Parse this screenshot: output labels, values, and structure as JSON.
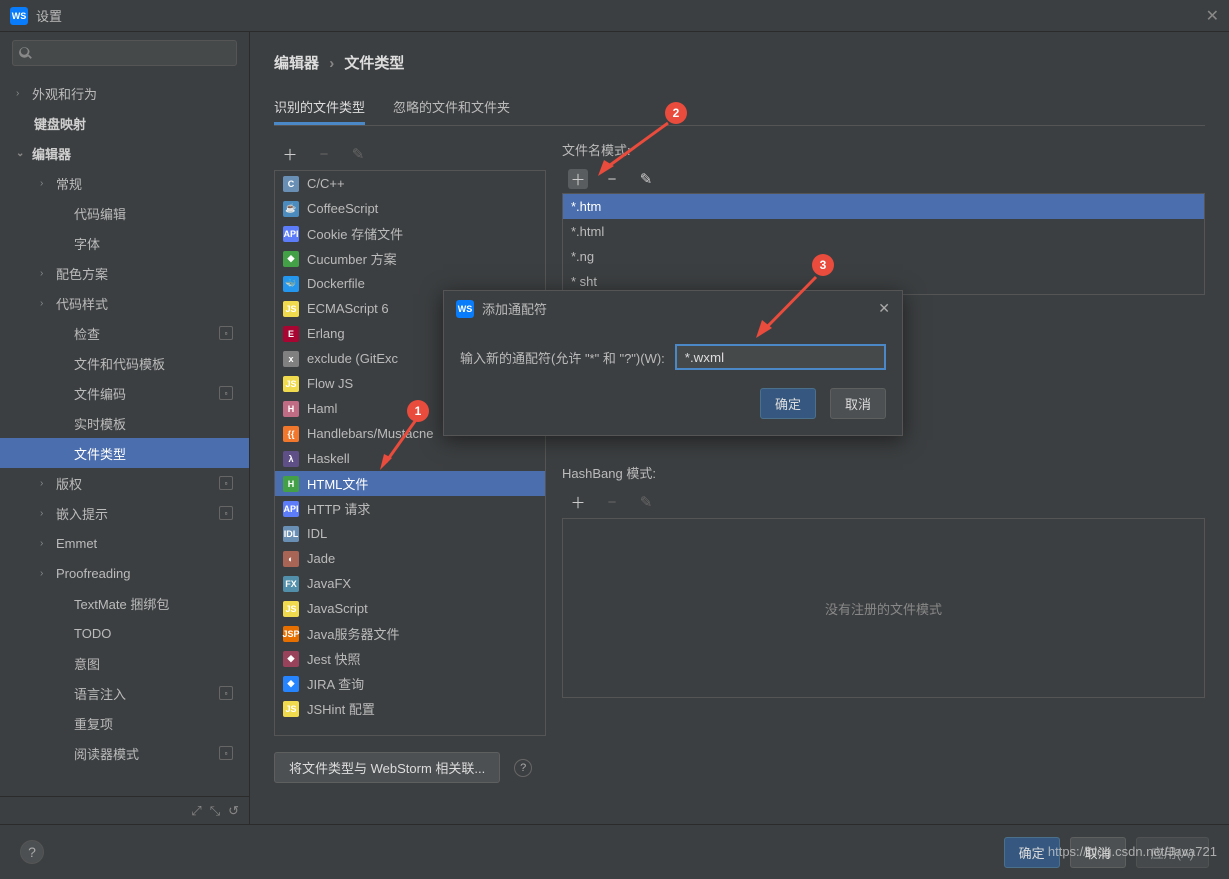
{
  "window": {
    "title": "设置"
  },
  "sidebar": {
    "items": [
      {
        "label": "外观和行为",
        "chev": "›",
        "level": 0
      },
      {
        "label": "键盘映射",
        "level": 0,
        "bold": true
      },
      {
        "label": "编辑器",
        "chev": "⌄",
        "level": 0,
        "bold": true
      },
      {
        "label": "常规",
        "chev": "›",
        "level": 1
      },
      {
        "label": "代码编辑",
        "level": 2
      },
      {
        "label": "字体",
        "level": 2
      },
      {
        "label": "配色方案",
        "chev": "›",
        "level": 1
      },
      {
        "label": "代码样式",
        "chev": "›",
        "level": 1
      },
      {
        "label": "检查",
        "level": 2,
        "badge": true
      },
      {
        "label": "文件和代码模板",
        "level": 2
      },
      {
        "label": "文件编码",
        "level": 2,
        "badge": true
      },
      {
        "label": "实时模板",
        "level": 2
      },
      {
        "label": "文件类型",
        "level": 2,
        "selected": true
      },
      {
        "label": "版权",
        "chev": "›",
        "level": 1,
        "badge": true
      },
      {
        "label": "嵌入提示",
        "chev": "›",
        "level": 1,
        "badge": true
      },
      {
        "label": "Emmet",
        "chev": "›",
        "level": 1
      },
      {
        "label": "Proofreading",
        "chev": "›",
        "level": 1
      },
      {
        "label": "TextMate 捆绑包",
        "level": 2
      },
      {
        "label": "TODO",
        "level": 2
      },
      {
        "label": "意图",
        "level": 2
      },
      {
        "label": "语言注入",
        "level": 2,
        "badge": true
      },
      {
        "label": "重复项",
        "level": 2
      },
      {
        "label": "阅读器模式",
        "level": 2,
        "badge": true
      }
    ]
  },
  "breadcrumb": {
    "a": "编辑器",
    "b": "文件类型"
  },
  "tabs": [
    {
      "label": "识别的文件类型",
      "active": true
    },
    {
      "label": "忽略的文件和文件夹",
      "active": false
    }
  ],
  "filetypes": [
    {
      "label": "C/C++",
      "bg": "#6a8fb5",
      "ic": "C"
    },
    {
      "label": "CoffeeScript",
      "bg": "#4b8bbe",
      "ic": "☕"
    },
    {
      "label": "Cookie 存储文件",
      "bg": "#5c7cfa",
      "ic": "API"
    },
    {
      "label": "Cucumber 方案",
      "bg": "#43a047",
      "ic": "◆"
    },
    {
      "label": "Dockerfile",
      "bg": "#2496ed",
      "ic": "🐳"
    },
    {
      "label": "ECMAScript 6",
      "bg": "#f0db4f",
      "ic": "JS"
    },
    {
      "label": "Erlang",
      "bg": "#a90533",
      "ic": "E"
    },
    {
      "label": "exclude (GitExc",
      "bg": "#808080",
      "ic": "x"
    },
    {
      "label": "Flow JS",
      "bg": "#f0db4f",
      "ic": "JS"
    },
    {
      "label": "Haml",
      "bg": "#c06c84",
      "ic": "H"
    },
    {
      "label": "Handlebars/Mustacne",
      "bg": "#f0772b",
      "ic": "{{"
    },
    {
      "label": "Haskell",
      "bg": "#5e5086",
      "ic": "λ"
    },
    {
      "label": "HTML文件",
      "bg": "#43a047",
      "ic": "H",
      "selected": true
    },
    {
      "label": "HTTP 请求",
      "bg": "#5c7cfa",
      "ic": "API"
    },
    {
      "label": "IDL",
      "bg": "#6a8fb5",
      "ic": "IDL"
    },
    {
      "label": "Jade",
      "bg": "#a86454",
      "ic": "◐"
    },
    {
      "label": "JavaFX",
      "bg": "#518faa",
      "ic": "FX"
    },
    {
      "label": "JavaScript",
      "bg": "#f0db4f",
      "ic": "JS"
    },
    {
      "label": "Java服务器文件",
      "bg": "#e76f00",
      "ic": "JSP"
    },
    {
      "label": "Jest 快照",
      "bg": "#99425b",
      "ic": "◆"
    },
    {
      "label": "JIRA 查询",
      "bg": "#2684ff",
      "ic": "◆"
    },
    {
      "label": "JSHint 配置",
      "bg": "#f0db4f",
      "ic": "JS"
    }
  ],
  "patterns_section": {
    "label": "文件名模式:"
  },
  "patterns": [
    {
      "label": "*.htm",
      "selected": true
    },
    {
      "label": "*.html"
    },
    {
      "label": "*.ng"
    },
    {
      "label": "* sht"
    }
  ],
  "hashbang": {
    "label": "HashBang 模式:",
    "empty_text": "没有注册的文件模式"
  },
  "associate_button": "将文件类型与 WebStorm 相关联...",
  "dialog": {
    "title": "添加通配符",
    "input_label": "输入新的通配符(允许 \"*\" 和 \"?\")(W):",
    "value": "*.wxml",
    "ok": "确定",
    "cancel": "取消"
  },
  "footer": {
    "ok": "确定",
    "cancel": "取消",
    "apply": "应用(A)"
  },
  "annotations": {
    "a1": "1",
    "a2": "2",
    "a3": "3"
  },
  "watermark": "https://blog.csdn.net/Java721"
}
